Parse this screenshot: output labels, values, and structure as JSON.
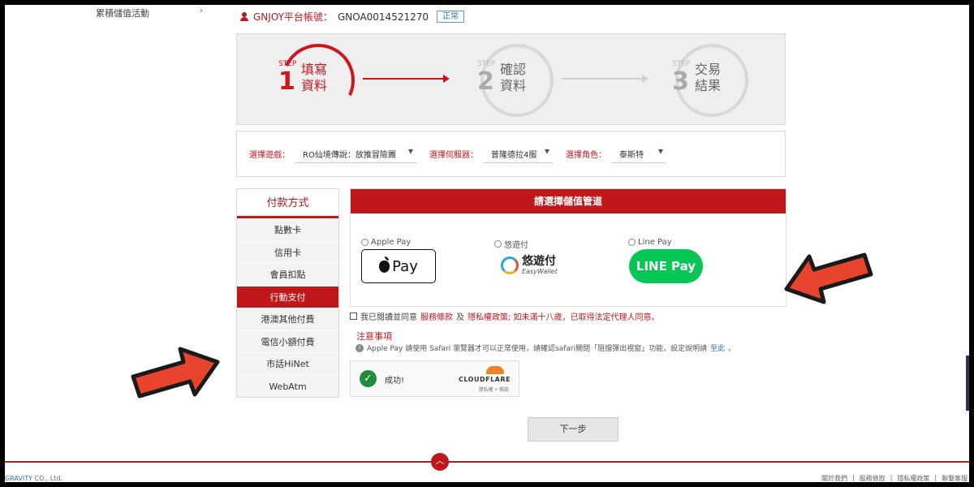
{
  "sidebar_top": {
    "text": "累積儲值活動",
    "arrow": "›"
  },
  "account": {
    "label": "GNJOY平台帳號：",
    "value": "GNOA0014521270",
    "status": "正常"
  },
  "steps": [
    {
      "step": "STEP",
      "num": "1",
      "text": "填寫資料",
      "active": true
    },
    {
      "step": "STEP",
      "num": "2",
      "text": "確認資料",
      "active": false
    },
    {
      "step": "STEP",
      "num": "3",
      "text": "交易結果",
      "active": false
    }
  ],
  "selectors": {
    "game_label": "選擇遊戲：",
    "game_value": "RO仙境傳說：放推冒險團",
    "server_label": "選擇伺服器：",
    "server_value": "普隆德拉4服",
    "char_label": "選擇角色：",
    "char_value": "泰斯特"
  },
  "payment_menu": {
    "title": "付款方式",
    "items": [
      "點數卡",
      "信用卡",
      "會員扣點",
      "行動支付",
      "港澳其他付費",
      "電信小額付費",
      "市話HiNet",
      "WebAtm"
    ],
    "active_index": 3
  },
  "channel": {
    "title": "請選擇儲值管道",
    "options": [
      {
        "label": "Apple Pay",
        "button": "Pay"
      },
      {
        "label": "悠遊付",
        "brand_zh": "悠遊付",
        "brand_en": "EasyWallet"
      },
      {
        "label": "Line Pay",
        "button": "LINE Pay"
      }
    ]
  },
  "agreement": {
    "prefix": "我已閱讀並同意",
    "terms": "服務條款",
    "and": "及",
    "privacy": "隱私權政策; 如未滿十八歲，已取得法定代理人同意。"
  },
  "notice": {
    "title": "注意事項",
    "text": "Apple Pay 請使用 Safari 瀏覽器才可以正常使用，請確認safari關閉「阻擋彈出視窗」功能，設定說明請",
    "link": "至此",
    "end": "。"
  },
  "captcha": {
    "status": "成功!",
    "brand": "CLOUDFLARE",
    "links": "隱私權 • 條款"
  },
  "next_button": "下一步",
  "footer": {
    "copyright_brand": "GRAVITY",
    "copyright_rest": " CO., Ltd.",
    "links": [
      "關於我們",
      "|",
      "服務條款",
      "|",
      "隱私權政策",
      "|",
      "聯繫客服"
    ]
  },
  "colors": {
    "brand_red": "#c0171b",
    "line_green": "#06c755",
    "link_blue": "#2f75b5",
    "arrow_red": "#e8432d"
  }
}
